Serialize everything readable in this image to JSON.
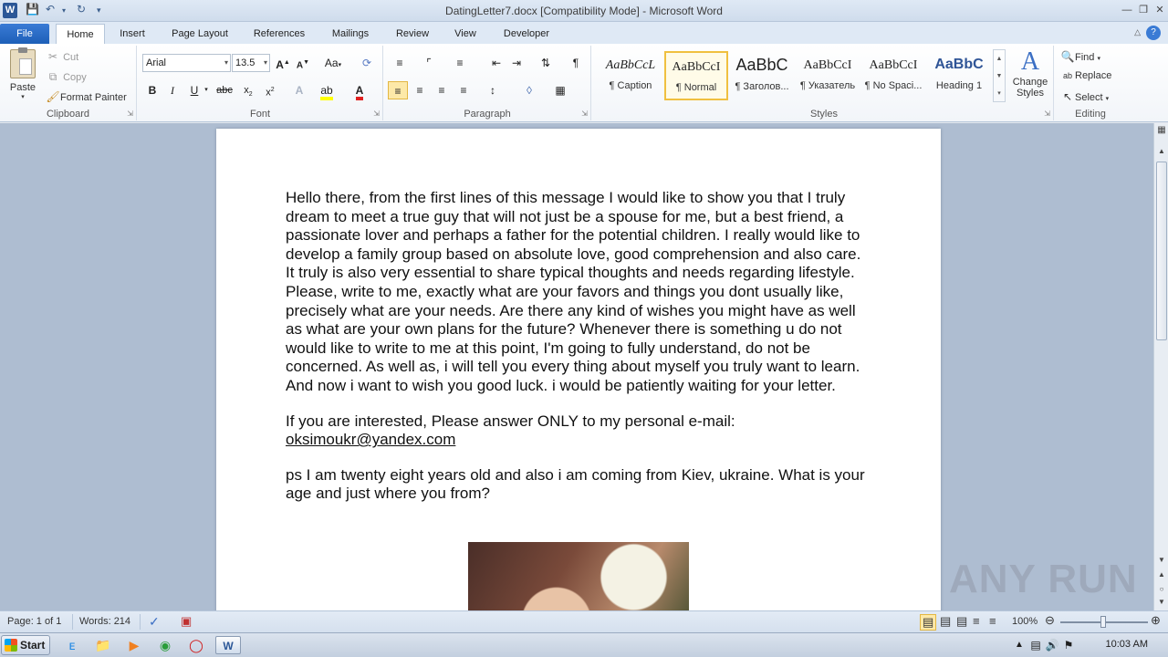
{
  "window": {
    "title": "DatingLetter7.docx [Compatibility Mode]  -  Microsoft Word"
  },
  "tabs": [
    {
      "label": "File"
    },
    {
      "label": "Home"
    },
    {
      "label": "Insert"
    },
    {
      "label": "Page Layout"
    },
    {
      "label": "References"
    },
    {
      "label": "Mailings"
    },
    {
      "label": "Review"
    },
    {
      "label": "View"
    },
    {
      "label": "Developer"
    }
  ],
  "clipboard": {
    "group_label": "Clipboard",
    "paste": "Paste",
    "cut": "Cut",
    "copy": "Copy",
    "format_painter": "Format Painter"
  },
  "font": {
    "group_label": "Font",
    "family": "Arial",
    "size": "13.5"
  },
  "paragraph": {
    "group_label": "Paragraph"
  },
  "styles": {
    "group_label": "Styles",
    "items": [
      {
        "sample": "AaBbCcL",
        "name": "¶ Caption"
      },
      {
        "sample": "AaBbCcI",
        "name": "¶ Normal"
      },
      {
        "sample": "AaBbC",
        "name": "¶ Заголов..."
      },
      {
        "sample": "AaBbCcI",
        "name": "¶ Указатель"
      },
      {
        "sample": "AaBbCcI",
        "name": "¶ No Spaci..."
      },
      {
        "sample": "AaBbC",
        "name": "Heading 1"
      }
    ],
    "change_styles": "Change Styles"
  },
  "editing": {
    "group_label": "Editing",
    "find": "Find",
    "replace": "Replace",
    "select": "Select"
  },
  "document": {
    "paragraph1": "Hello there, from the first lines of this message I would like to show you that I truly dream to meet a true guy that will not just be a spouse for me, but a best friend, a passionate lover and perhaps a father for the potential children. I really would like to develop a family group based on absolute love, good comprehension and also care. It truly is also very essential to share typical thoughts and needs regarding lifestyle. Please, write to me, exactly what are your favors and things you dont usually like, precisely what are your needs. Are there any kind of wishes you might have as well as what are your own plans for the future? Whenever there is something u do not would like to write to me at this point, I'm  going to fully understand, do not be concerned. As well as, i will tell you every thing about myself you truly want to learn. And now i want to wish you good luck. i would be patiently waiting for your letter.",
    "paragraph2_prefix": "If you are interested, Please answer ONLY to my personal e-mail: ",
    "email": "oksimoukr@yandex.com",
    "paragraph3": "ps I am twenty eight years old and also i am coming from Kiev, ukraine. What is your age and just where you from?"
  },
  "status": {
    "page": "Page: 1 of 1",
    "words": "Words: 214",
    "zoom": "100%"
  },
  "taskbar": {
    "start": "Start",
    "clock": "10:03 AM"
  },
  "watermark": "ANY RUN"
}
